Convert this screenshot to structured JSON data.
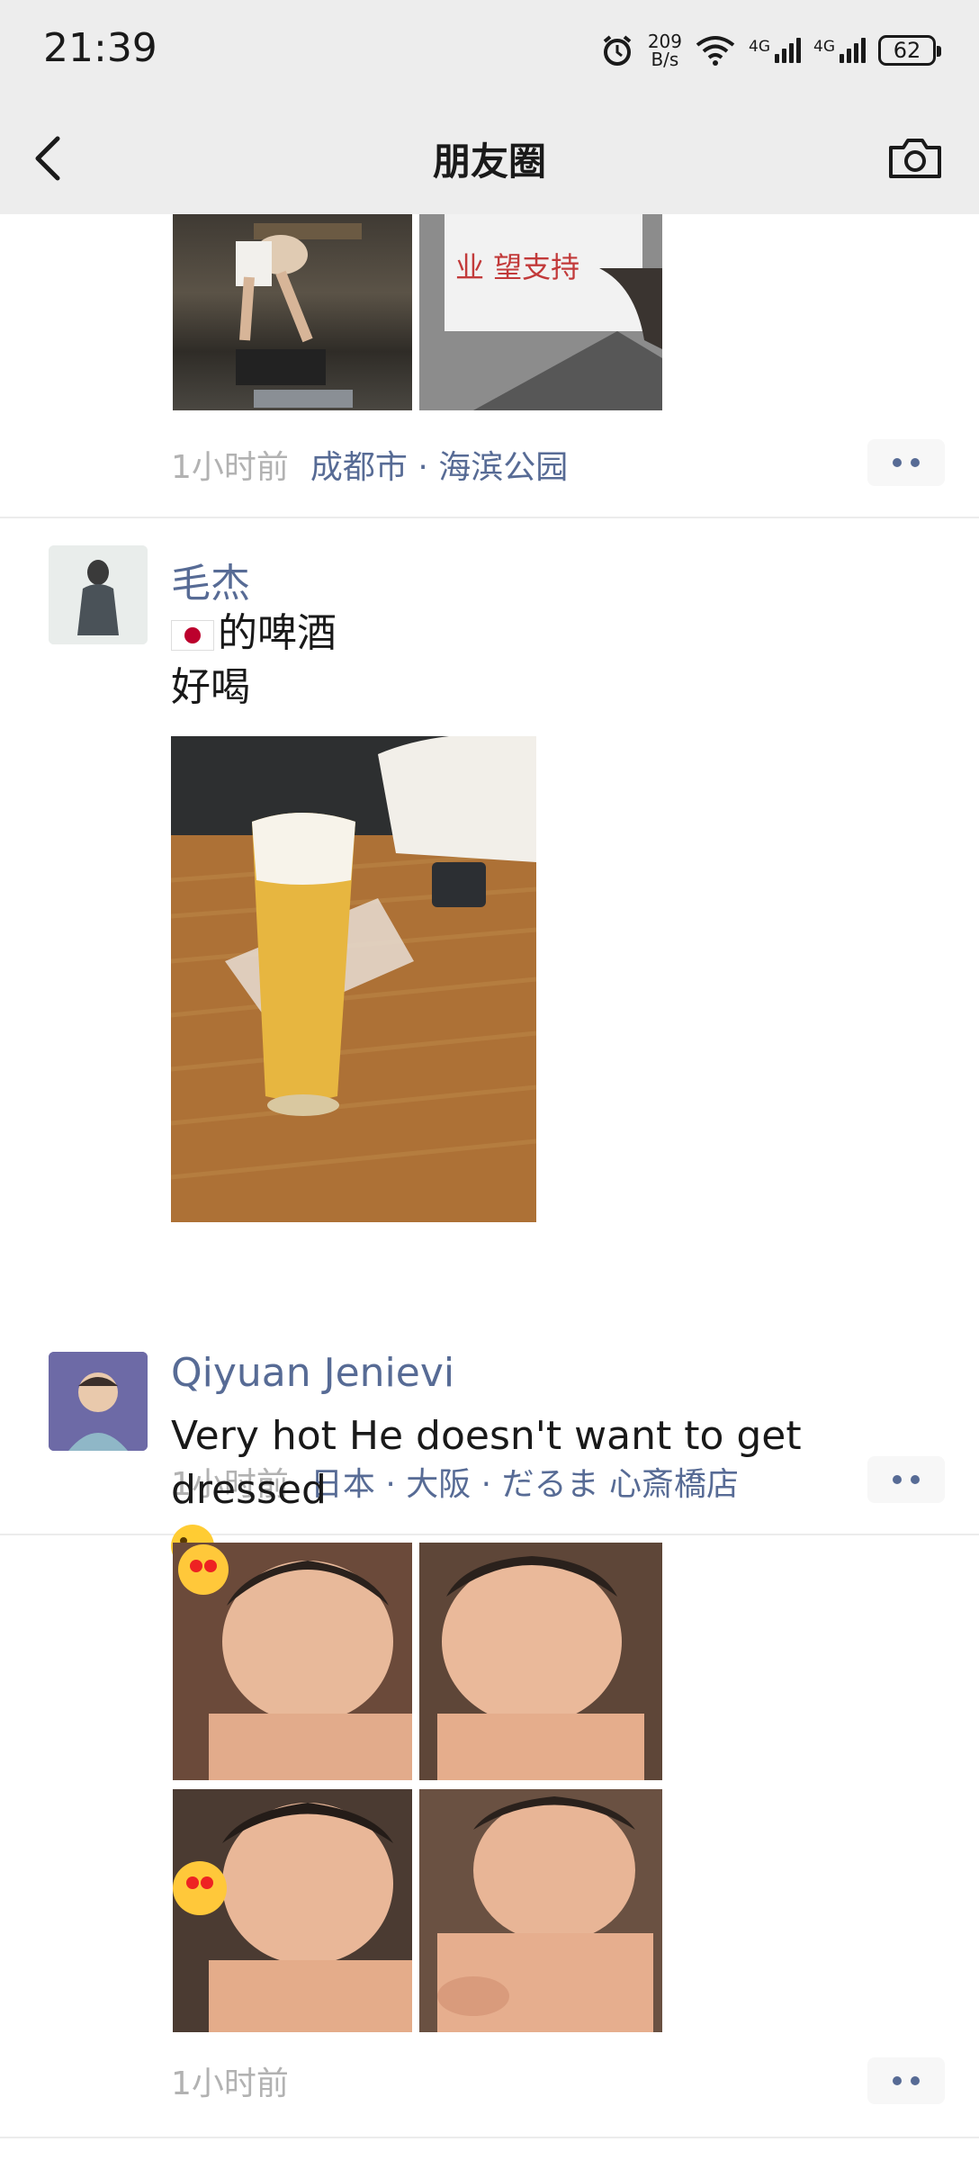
{
  "status_bar": {
    "time": "21:39",
    "net_speed_value": "209",
    "net_speed_unit": "B/s",
    "signal1_label": "4G",
    "signal2_label": "4G",
    "battery": "62",
    "icons": [
      "alarm-icon",
      "wifi-icon",
      "signal-icon",
      "signal-icon",
      "battery-icon"
    ]
  },
  "nav": {
    "title": "朋友圈",
    "back_icon": "chevron-left-icon",
    "camera_icon": "camera-icon"
  },
  "posts": [
    {
      "time": "1小时前",
      "location": "成都市 · 海滨公园",
      "photos": [
        "girl-sitting-on-bench-photo",
        "handwritten-sign-photo"
      ],
      "sign_text": "业 望支持"
    },
    {
      "author": "毛杰",
      "text_line1": "的啤酒",
      "text_line2": "好喝",
      "flag": "japan-flag-emoji",
      "photos": [
        "beer-glass-photo"
      ],
      "time": "1小时前",
      "location": "日本 · 大阪 · だるま 心斎橋店"
    },
    {
      "author": "Qiyuan  Jenievi",
      "text": "Very hot He doesn't want to get dressed",
      "emoji": "winking-face-tongue-emoji",
      "photos": [
        "toddler-photo-1",
        "toddler-photo-2",
        "toddler-photo-3",
        "toddler-photo-4"
      ],
      "time": "1小时前"
    }
  ],
  "colors": {
    "link": "#576b95",
    "meta": "#b2b2b2",
    "bar_bg": "#ededed"
  }
}
